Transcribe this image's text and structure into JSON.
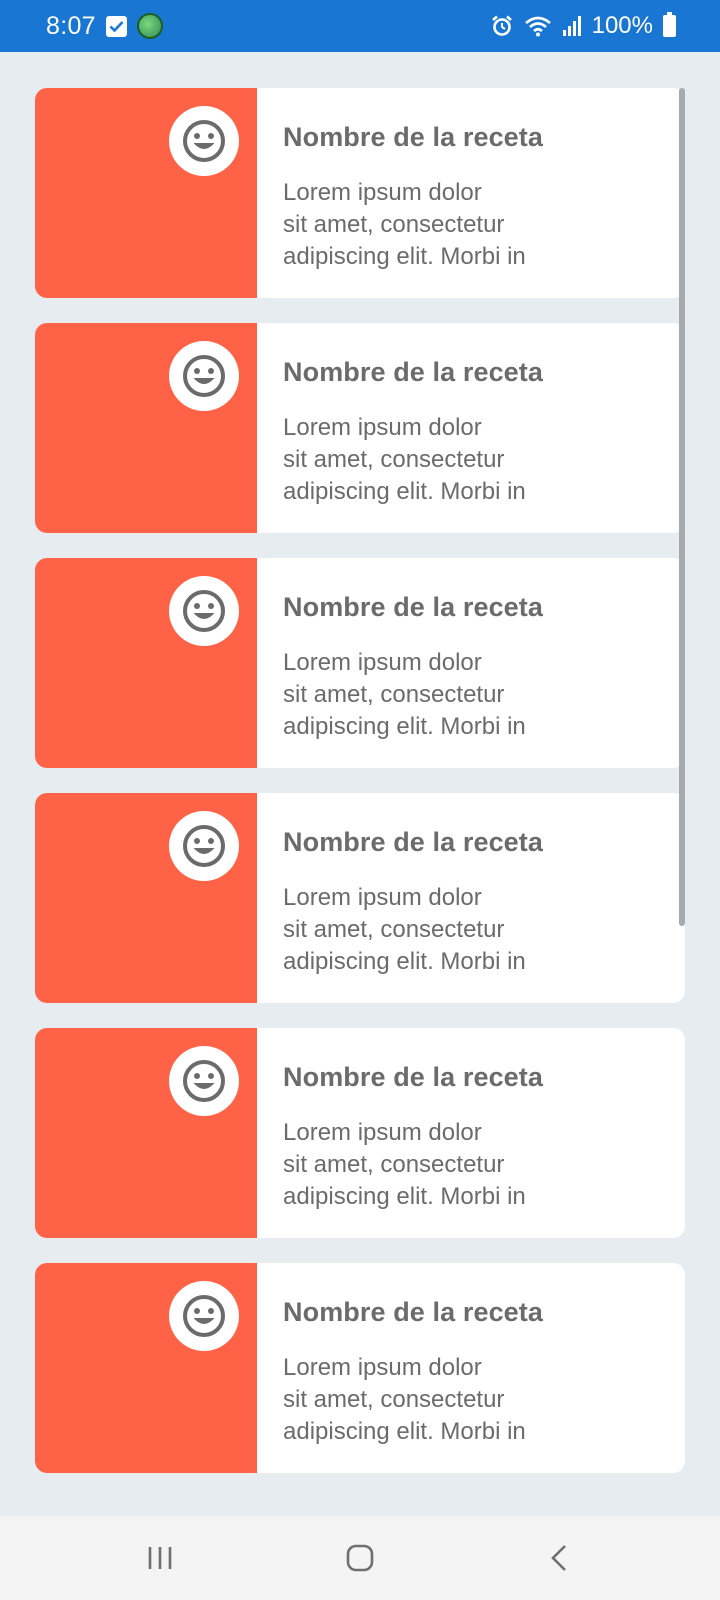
{
  "status_bar": {
    "time": "8:07",
    "battery_percent": "100%",
    "icons": [
      "checkbox-icon",
      "app-notification-icon",
      "alarm-icon",
      "wifi-icon",
      "signal-icon",
      "battery-icon"
    ]
  },
  "colors": {
    "status_bar_bg": "#1976d2",
    "card_image_bg": "#ff6347",
    "page_bg": "#e6ecf0",
    "text": "#6b6b6b"
  },
  "recipes": [
    {
      "icon": "smile-icon",
      "title": "Nombre de la receta",
      "lines": [
        "Lorem ipsum dolor",
        "sit amet, consectetur",
        "adipiscing elit. Morbi in"
      ]
    },
    {
      "icon": "smile-icon",
      "title": "Nombre de la receta",
      "lines": [
        "Lorem ipsum dolor",
        "sit amet, consectetur",
        "adipiscing elit. Morbi in"
      ]
    },
    {
      "icon": "smile-icon",
      "title": "Nombre de la receta",
      "lines": [
        "Lorem ipsum dolor",
        "sit amet, consectetur",
        "adipiscing elit. Morbi in"
      ]
    },
    {
      "icon": "smile-icon",
      "title": "Nombre de la receta",
      "lines": [
        "Lorem ipsum dolor",
        "sit amet, consectetur",
        "adipiscing elit. Morbi in"
      ]
    },
    {
      "icon": "smile-icon",
      "title": "Nombre de la receta",
      "lines": [
        "Lorem ipsum dolor",
        "sit amet, consectetur",
        "adipiscing elit. Morbi in"
      ]
    },
    {
      "icon": "smile-icon",
      "title": "Nombre de la receta",
      "lines": [
        "Lorem ipsum dolor",
        "sit amet, consectetur",
        "adipiscing elit. Morbi in"
      ]
    }
  ],
  "nav_bar": {
    "buttons": [
      "recents-icon",
      "home-icon",
      "back-icon"
    ]
  }
}
